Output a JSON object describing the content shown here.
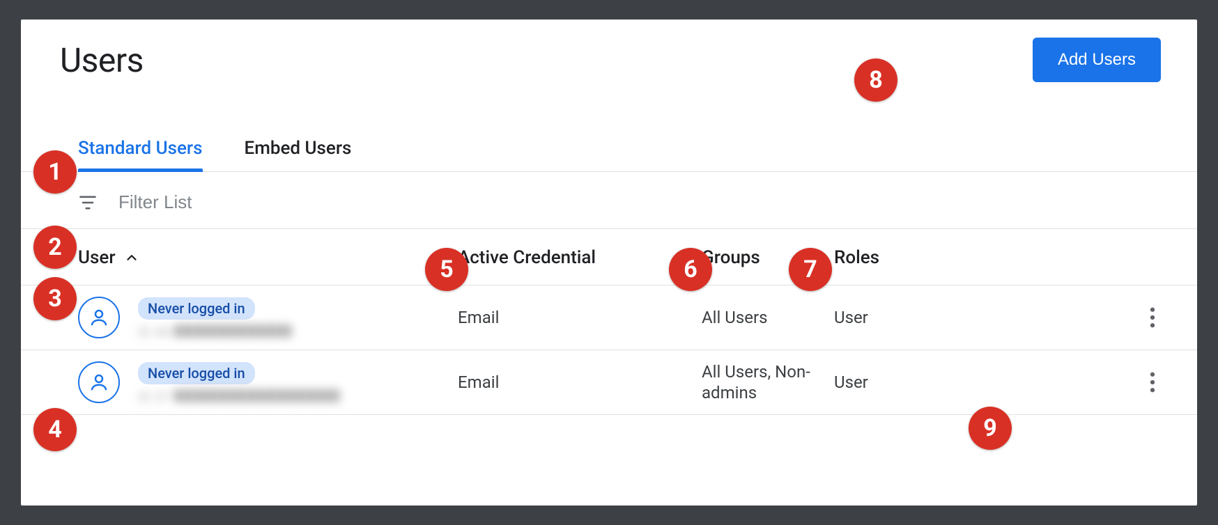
{
  "header": {
    "title": "Users",
    "add_button_label": "Add Users"
  },
  "tabs": [
    {
      "label": "Standard Users",
      "active": true
    },
    {
      "label": "Embed Users",
      "active": false
    }
  ],
  "filter": {
    "placeholder": "Filter List"
  },
  "columns": {
    "user": "User",
    "credential": "Active Credential",
    "groups": "Groups",
    "roles": "Roles"
  },
  "rows": [
    {
      "badge": "Never logged in",
      "credential": "Email",
      "groups": "All Users",
      "roles": "User"
    },
    {
      "badge": "Never logged in",
      "credential": "Email",
      "groups": "All Users, Non-admins",
      "roles": "User"
    }
  ],
  "annotations": [
    "1",
    "2",
    "3",
    "4",
    "5",
    "6",
    "7",
    "8",
    "9"
  ]
}
